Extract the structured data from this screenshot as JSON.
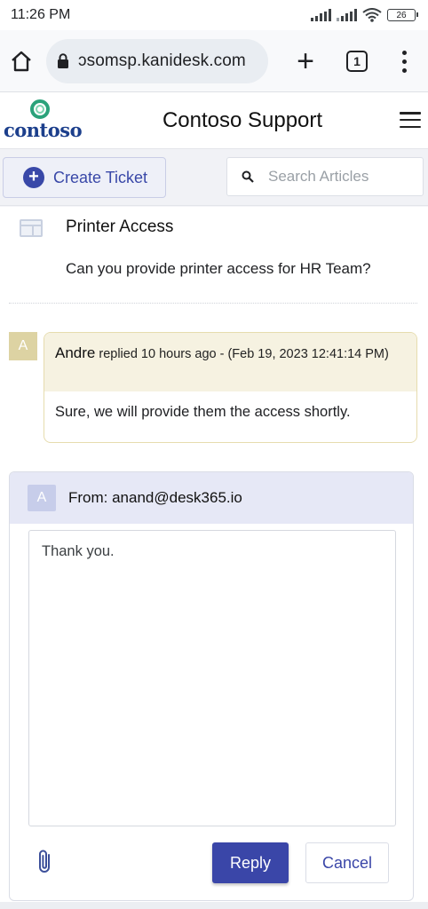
{
  "status_bar": {
    "time": "11:26 PM",
    "battery": "26"
  },
  "browser": {
    "url": "ɔsomsp.kanidesk.com",
    "tab_count": "1",
    "new_tab_glyph": "+"
  },
  "site": {
    "logo_text": "contoso",
    "title": "Contoso Support"
  },
  "actions": {
    "create_ticket": "Create Ticket",
    "search_placeholder": "Search Articles",
    "create_icon_glyph": "+"
  },
  "ticket": {
    "title": "Printer Access",
    "description": "Can you provide printer access for HR Team?"
  },
  "reply": {
    "avatar": "A",
    "author": "Andre",
    "meta": "replied 10 hours ago - (Feb 19, 2023 12:41:14 PM)",
    "body": "Sure, we will provide them the access shortly."
  },
  "compose": {
    "avatar": "A",
    "from": "From: anand@desk365.io",
    "text": "Thank you.",
    "reply_label": "Reply",
    "cancel_label": "Cancel"
  },
  "colors": {
    "accent": "#3a46a8",
    "logo_green": "#2aa27a",
    "logo_blue": "#1c3f8c",
    "reply_bg": "#f6f2e1"
  },
  "icons": [
    "wifi-icon",
    "signal-icon",
    "battery-icon",
    "home-icon",
    "lock-icon",
    "plus-icon",
    "tab-switcher-icon",
    "overflow-menu-icon",
    "hamburger-menu-icon",
    "plus-circle-icon",
    "search-icon",
    "ticket-icon",
    "paperclip-icon"
  ]
}
